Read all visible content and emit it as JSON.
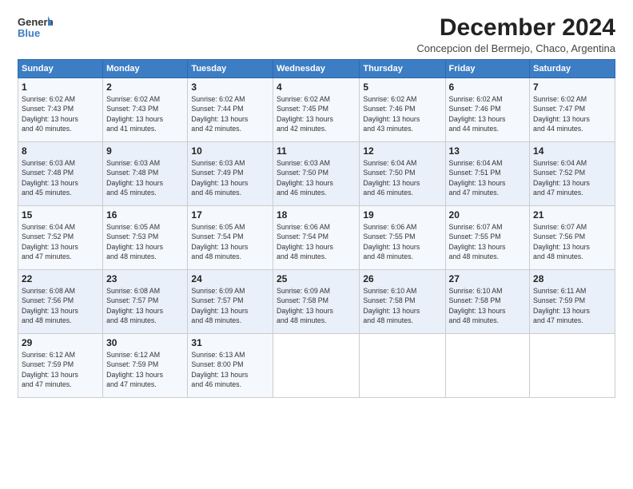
{
  "logo": {
    "line1": "General",
    "line2": "Blue"
  },
  "title": "December 2024",
  "subtitle": "Concepcion del Bermejo, Chaco, Argentina",
  "days_of_week": [
    "Sunday",
    "Monday",
    "Tuesday",
    "Wednesday",
    "Thursday",
    "Friday",
    "Saturday"
  ],
  "weeks": [
    [
      {
        "day": "1",
        "info": "Sunrise: 6:02 AM\nSunset: 7:43 PM\nDaylight: 13 hours\nand 40 minutes."
      },
      {
        "day": "2",
        "info": "Sunrise: 6:02 AM\nSunset: 7:43 PM\nDaylight: 13 hours\nand 41 minutes."
      },
      {
        "day": "3",
        "info": "Sunrise: 6:02 AM\nSunset: 7:44 PM\nDaylight: 13 hours\nand 42 minutes."
      },
      {
        "day": "4",
        "info": "Sunrise: 6:02 AM\nSunset: 7:45 PM\nDaylight: 13 hours\nand 42 minutes."
      },
      {
        "day": "5",
        "info": "Sunrise: 6:02 AM\nSunset: 7:46 PM\nDaylight: 13 hours\nand 43 minutes."
      },
      {
        "day": "6",
        "info": "Sunrise: 6:02 AM\nSunset: 7:46 PM\nDaylight: 13 hours\nand 44 minutes."
      },
      {
        "day": "7",
        "info": "Sunrise: 6:02 AM\nSunset: 7:47 PM\nDaylight: 13 hours\nand 44 minutes."
      }
    ],
    [
      {
        "day": "8",
        "info": "Sunrise: 6:03 AM\nSunset: 7:48 PM\nDaylight: 13 hours\nand 45 minutes."
      },
      {
        "day": "9",
        "info": "Sunrise: 6:03 AM\nSunset: 7:48 PM\nDaylight: 13 hours\nand 45 minutes."
      },
      {
        "day": "10",
        "info": "Sunrise: 6:03 AM\nSunset: 7:49 PM\nDaylight: 13 hours\nand 46 minutes."
      },
      {
        "day": "11",
        "info": "Sunrise: 6:03 AM\nSunset: 7:50 PM\nDaylight: 13 hours\nand 46 minutes."
      },
      {
        "day": "12",
        "info": "Sunrise: 6:04 AM\nSunset: 7:50 PM\nDaylight: 13 hours\nand 46 minutes."
      },
      {
        "day": "13",
        "info": "Sunrise: 6:04 AM\nSunset: 7:51 PM\nDaylight: 13 hours\nand 47 minutes."
      },
      {
        "day": "14",
        "info": "Sunrise: 6:04 AM\nSunset: 7:52 PM\nDaylight: 13 hours\nand 47 minutes."
      }
    ],
    [
      {
        "day": "15",
        "info": "Sunrise: 6:04 AM\nSunset: 7:52 PM\nDaylight: 13 hours\nand 47 minutes."
      },
      {
        "day": "16",
        "info": "Sunrise: 6:05 AM\nSunset: 7:53 PM\nDaylight: 13 hours\nand 48 minutes."
      },
      {
        "day": "17",
        "info": "Sunrise: 6:05 AM\nSunset: 7:54 PM\nDaylight: 13 hours\nand 48 minutes."
      },
      {
        "day": "18",
        "info": "Sunrise: 6:06 AM\nSunset: 7:54 PM\nDaylight: 13 hours\nand 48 minutes."
      },
      {
        "day": "19",
        "info": "Sunrise: 6:06 AM\nSunset: 7:55 PM\nDaylight: 13 hours\nand 48 minutes."
      },
      {
        "day": "20",
        "info": "Sunrise: 6:07 AM\nSunset: 7:55 PM\nDaylight: 13 hours\nand 48 minutes."
      },
      {
        "day": "21",
        "info": "Sunrise: 6:07 AM\nSunset: 7:56 PM\nDaylight: 13 hours\nand 48 minutes."
      }
    ],
    [
      {
        "day": "22",
        "info": "Sunrise: 6:08 AM\nSunset: 7:56 PM\nDaylight: 13 hours\nand 48 minutes."
      },
      {
        "day": "23",
        "info": "Sunrise: 6:08 AM\nSunset: 7:57 PM\nDaylight: 13 hours\nand 48 minutes."
      },
      {
        "day": "24",
        "info": "Sunrise: 6:09 AM\nSunset: 7:57 PM\nDaylight: 13 hours\nand 48 minutes."
      },
      {
        "day": "25",
        "info": "Sunrise: 6:09 AM\nSunset: 7:58 PM\nDaylight: 13 hours\nand 48 minutes."
      },
      {
        "day": "26",
        "info": "Sunrise: 6:10 AM\nSunset: 7:58 PM\nDaylight: 13 hours\nand 48 minutes."
      },
      {
        "day": "27",
        "info": "Sunrise: 6:10 AM\nSunset: 7:58 PM\nDaylight: 13 hours\nand 48 minutes."
      },
      {
        "day": "28",
        "info": "Sunrise: 6:11 AM\nSunset: 7:59 PM\nDaylight: 13 hours\nand 47 minutes."
      }
    ],
    [
      {
        "day": "29",
        "info": "Sunrise: 6:12 AM\nSunset: 7:59 PM\nDaylight: 13 hours\nand 47 minutes."
      },
      {
        "day": "30",
        "info": "Sunrise: 6:12 AM\nSunset: 7:59 PM\nDaylight: 13 hours\nand 47 minutes."
      },
      {
        "day": "31",
        "info": "Sunrise: 6:13 AM\nSunset: 8:00 PM\nDaylight: 13 hours\nand 46 minutes."
      },
      null,
      null,
      null,
      null
    ]
  ]
}
